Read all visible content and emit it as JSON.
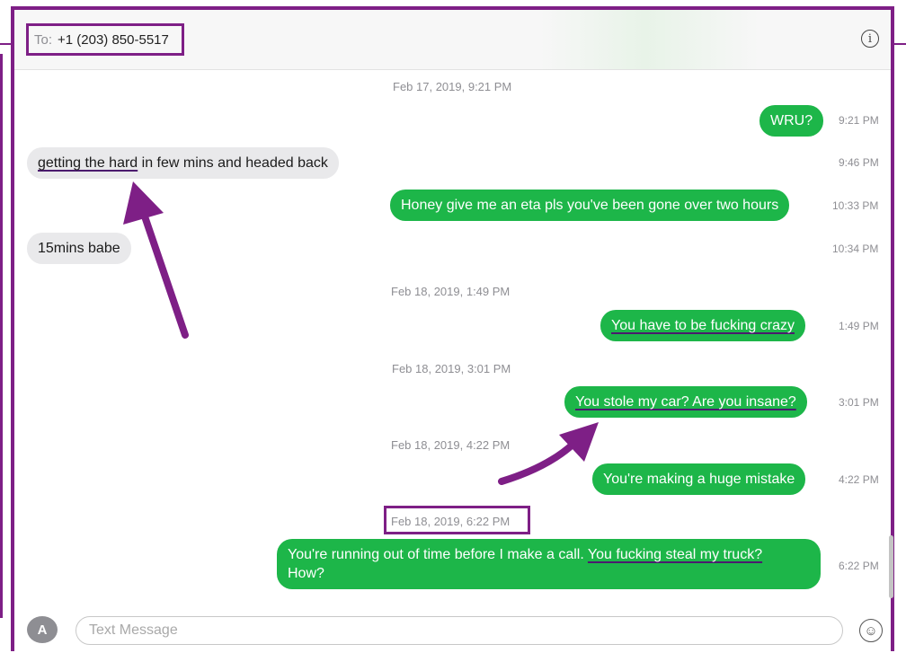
{
  "header": {
    "to_label": "To:",
    "recipient": "+1 (203) 850-5517",
    "info_icon": "info-icon"
  },
  "dates": {
    "d1": "Feb 17, 2019, 9:21 PM",
    "d2": "Feb 18, 2019, 1:49 PM",
    "d3": "Feb 18, 2019, 3:01 PM",
    "d4": "Feb 18, 2019, 4:22 PM",
    "d5": "Feb 18, 2019, 6:22 PM"
  },
  "messages": [
    {
      "direction": "sent",
      "text": "WRU?",
      "time": "9:21 PM"
    },
    {
      "direction": "received",
      "text_underlined": "getting the hard",
      "text_rest": " in few mins and headed back",
      "time": "9:46 PM"
    },
    {
      "direction": "sent",
      "text": "Honey give me an eta pls you've been gone over two hours",
      "time": "10:33 PM"
    },
    {
      "direction": "received",
      "text": "15mins babe",
      "time": "10:34 PM"
    },
    {
      "direction": "sent",
      "text": "You have to be fucking crazy",
      "time": "1:49 PM"
    },
    {
      "direction": "sent",
      "text": "You stole my car? Are you insane?",
      "time": "3:01 PM"
    },
    {
      "direction": "sent",
      "text": "You're making a huge mistake",
      "time": "4:22 PM"
    },
    {
      "direction": "sent",
      "text_before": "You're running out of time before I make a call. ",
      "text_underlined": "You fucking steal my truck?",
      "text_line2": "How?",
      "time": "6:22 PM"
    }
  ],
  "composer": {
    "placeholder": "Text Message",
    "apps_icon": "app-store-icon",
    "emoji_icon": "emoji-icon"
  },
  "colors": {
    "annotation": "#7e1f86",
    "sent_bubble": "#1db649",
    "received_bubble": "#e9e9eb"
  }
}
